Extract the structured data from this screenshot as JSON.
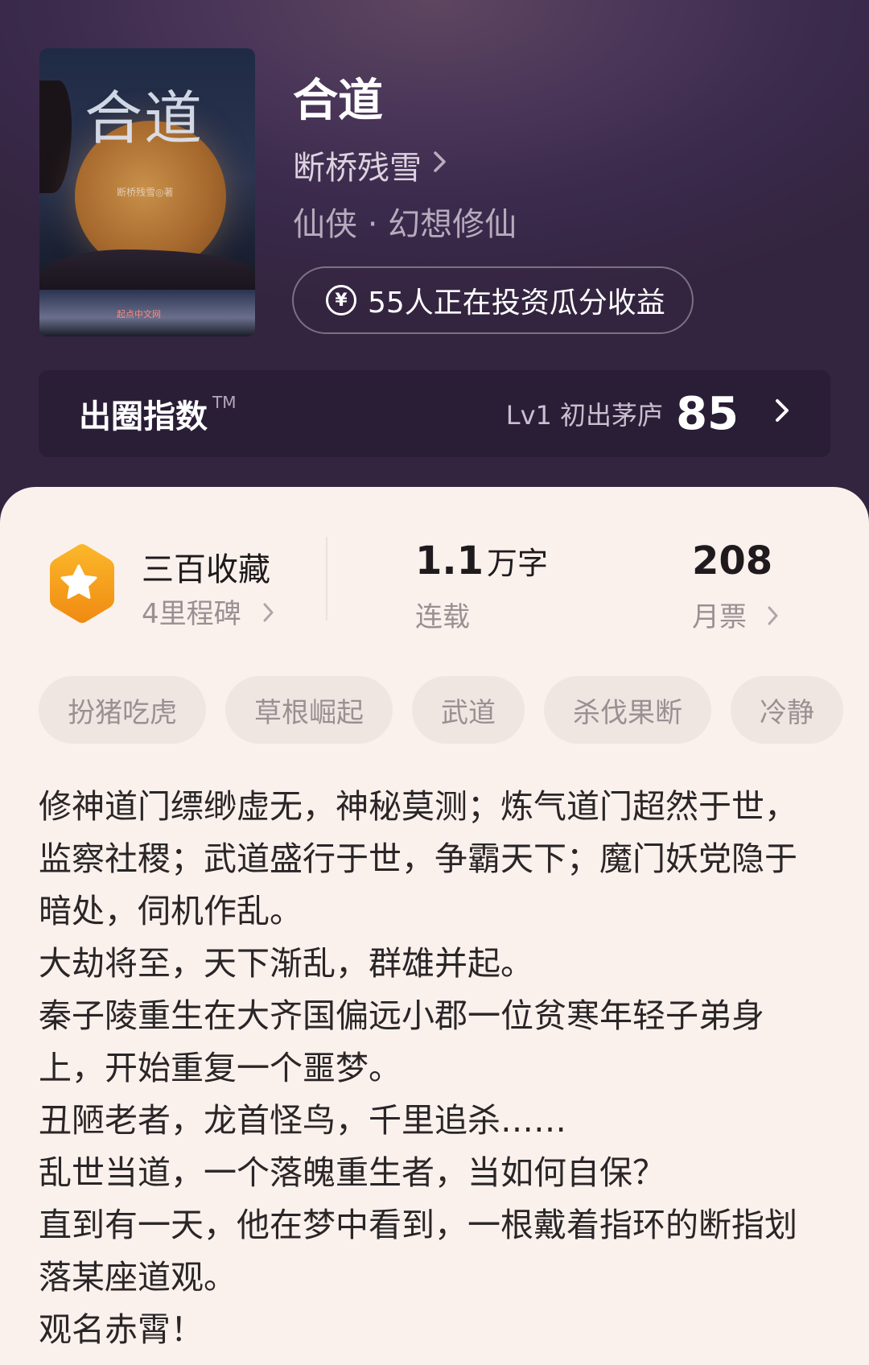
{
  "book": {
    "title": "合道",
    "author": "断桥残雪",
    "genre": "仙侠 · 幻想修仙",
    "invest_text": "55人正在投资瓜分收益",
    "cover": {
      "title": "合道",
      "author": "断桥残雪◎著",
      "publisher": "起点中文网"
    }
  },
  "index_bar": {
    "label": "出圈指数",
    "tm": "TM",
    "level": "Lv1 初出茅庐",
    "score": "85"
  },
  "stats": {
    "collection_title": "三百收藏",
    "milestone": "4里程碑",
    "word_count_value": "1.1",
    "word_count_unit": "万字",
    "status": "连载",
    "monthly_votes": "208",
    "monthly_votes_label": "月票"
  },
  "tags": [
    "扮猪吃虎",
    "草根崛起",
    "武道",
    "杀伐果断",
    "冷静"
  ],
  "synopsis": [
    "修神道门缥缈虚无，神秘莫测；炼气道门超然于世，监察社稷；武道盛行于世，争霸天下；魔门妖党隐于暗处，伺机作乱。",
    "大劫将至，天下渐乱，群雄并起。",
    "秦子陵重生在大齐国偏远小郡一位贫寒年轻子弟身上，开始重复一个噩梦。",
    "丑陋老者，龙首怪鸟，千里追杀……",
    "乱世当道，一个落魄重生者，当如何自保？",
    "直到有一天，他在梦中看到，一根戴着指环的断指划落某座道观。",
    "观名赤霄！"
  ],
  "colors": {
    "hero_bg": "#3b2a4c",
    "card_bg": "#faf1ec",
    "badge_orange": "#f7a21b"
  },
  "icons": {
    "author_chevron": "chevron-right-icon",
    "invest": "yen-circle-icon",
    "badge": "star-hexagon-icon"
  }
}
